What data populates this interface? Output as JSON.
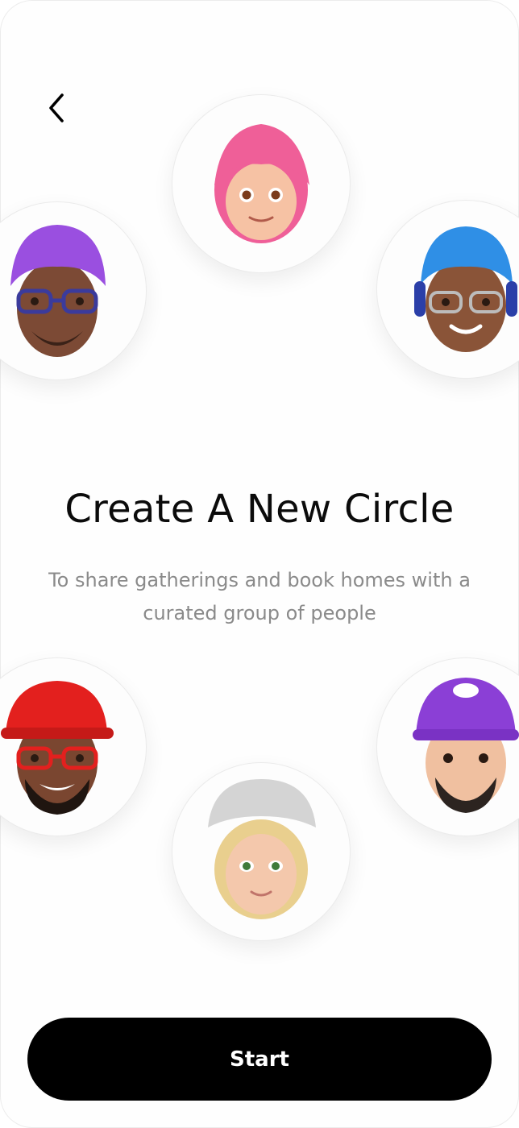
{
  "header": {
    "back_icon": "chevron-left-icon"
  },
  "main": {
    "title": "Create A New Circle",
    "subtitle": "To share gatherings and book homes with a curated group of people"
  },
  "avatars": [
    {
      "name": "pink-hair-memoji-icon",
      "hair": "#ef5f98"
    },
    {
      "name": "purple-hair-glasses-memoji-icon",
      "hair": "#9a4fe0"
    },
    {
      "name": "blue-hair-headphones-memoji-icon",
      "hair": "#2f8fe6"
    },
    {
      "name": "red-cap-glasses-memoji-icon",
      "hat": "#e3201e"
    },
    {
      "name": "purple-cap-beard-memoji-icon",
      "hat": "#8b3fd6"
    },
    {
      "name": "grey-beret-blonde-memoji-icon",
      "hat": "#d4d4d4"
    }
  ],
  "footer": {
    "start_label": "Start"
  },
  "colors": {
    "button_bg": "#000000",
    "button_text": "#ffffff",
    "subtitle": "#8a8a8a"
  }
}
